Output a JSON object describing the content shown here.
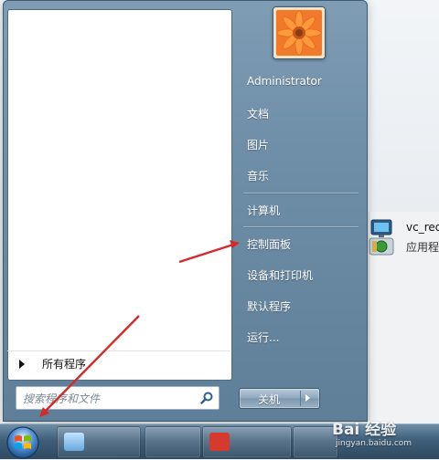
{
  "start_menu": {
    "user_name": "Administrator",
    "links_group1": [
      {
        "name": "right-link-documents",
        "label": "文档"
      },
      {
        "name": "right-link-pictures",
        "label": "图片"
      },
      {
        "name": "right-link-music",
        "label": "音乐"
      }
    ],
    "links_group2": [
      {
        "name": "right-link-computer",
        "label": "计算机"
      }
    ],
    "links_group3": [
      {
        "name": "right-link-control-panel",
        "label": "控制面板"
      },
      {
        "name": "right-link-devices-printers",
        "label": "设备和打印机"
      },
      {
        "name": "right-link-default-programs",
        "label": "默认程序"
      },
      {
        "name": "right-link-run",
        "label": "运行..."
      }
    ],
    "all_programs_label": "所有程序",
    "search_placeholder": "搜索程序和文件",
    "shutdown_label": "关机"
  },
  "desktop": {
    "item_title": "vc_red",
    "item_subtitle": "应用程"
  },
  "watermark": {
    "main": "Bai 经验",
    "url": "jingyan.baidu.com"
  },
  "icons": {
    "avatar": "flower-avatar",
    "search": "magnifier-icon",
    "start": "windows-orb-icon"
  },
  "colors": {
    "start_menu": "#6f8ea8",
    "taskbar": "#3f5e79",
    "annotation_arrow": "#d42a2a"
  }
}
